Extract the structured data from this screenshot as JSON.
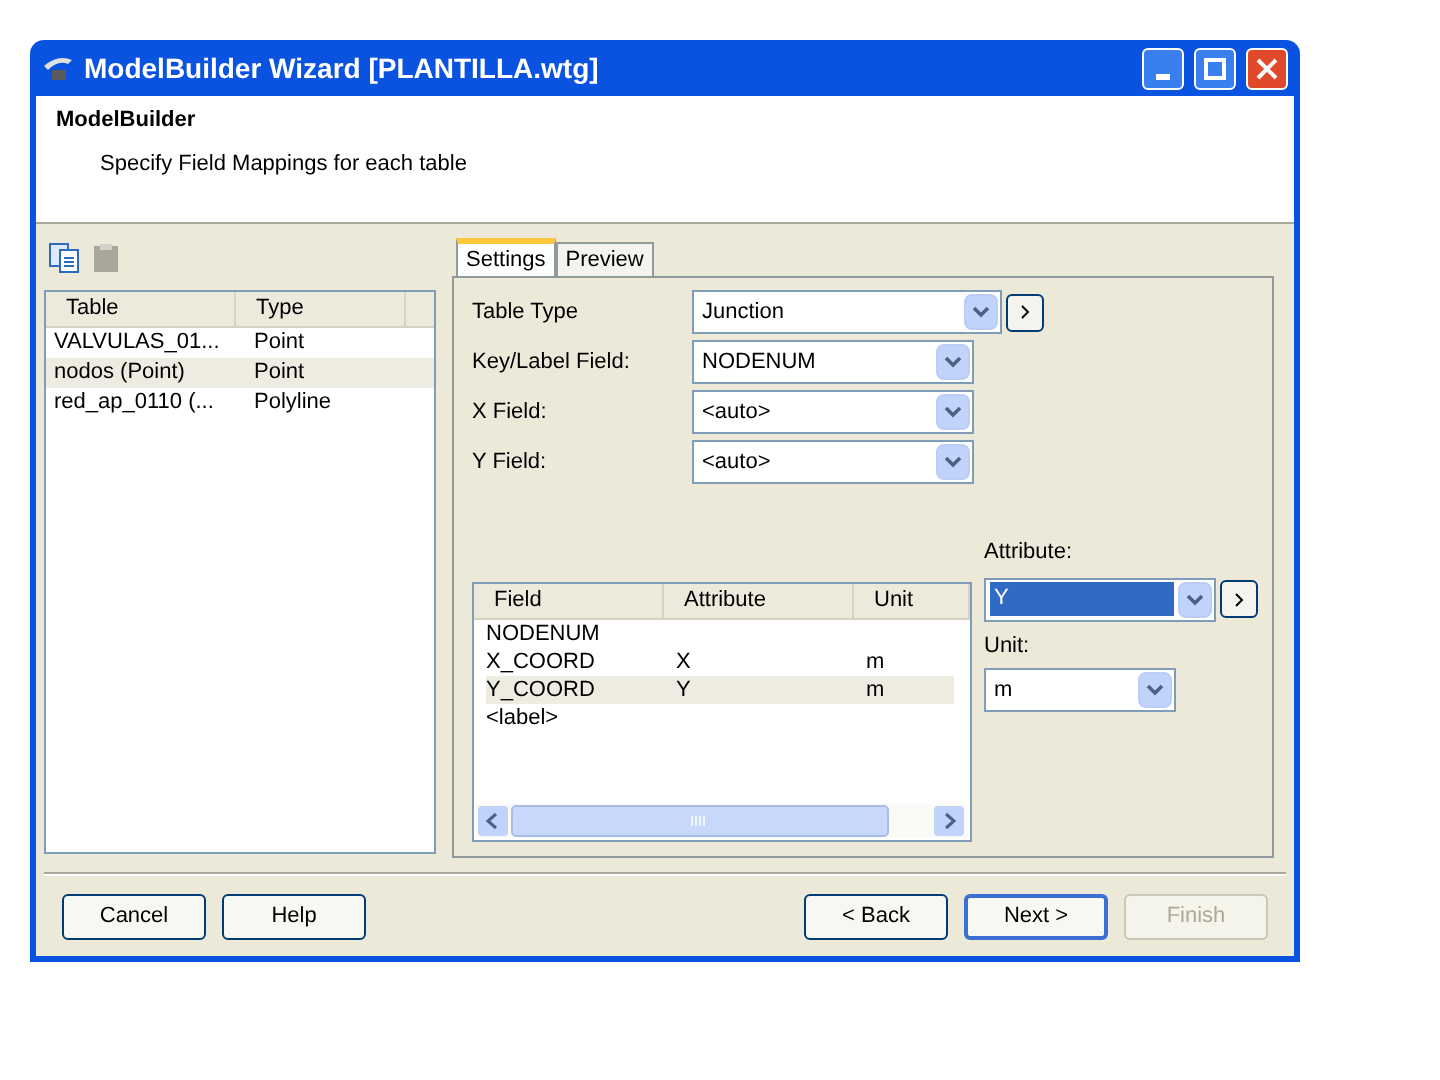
{
  "window": {
    "title": "ModelBuilder Wizard [PLANTILLA.wtg]"
  },
  "header": {
    "title": "ModelBuilder",
    "subtitle": "Specify Field Mappings for each table"
  },
  "toolbar": [
    {
      "kind": "copy",
      "disabled": false
    },
    {
      "kind": "paste",
      "disabled": true
    }
  ],
  "tables": {
    "columns": [
      "Table",
      "Type"
    ],
    "rows": [
      {
        "cells": [
          "VALVULAS_01...",
          "Point"
        ],
        "selected": false
      },
      {
        "cells": [
          "nodos (Point)",
          "Point"
        ],
        "selected": true
      },
      {
        "cells": [
          "red_ap_0110 (...",
          "Polyline"
        ],
        "selected": false
      }
    ]
  },
  "tabs": [
    {
      "label": "Settings",
      "selected": true
    },
    {
      "label": "Preview",
      "selected": false
    }
  ],
  "form": [
    {
      "label": "Table Type",
      "value": "Junction",
      "more_button": true
    },
    {
      "label": "Key/Label Field:",
      "value": "NODENUM",
      "more_button": false
    },
    {
      "label": "X Field:",
      "value": "<auto>",
      "more_button": false
    },
    {
      "label": "Y Field:",
      "value": "<auto>",
      "more_button": false
    }
  ],
  "mappings": {
    "columns": [
      "Field",
      "Attribute",
      "Unit"
    ],
    "rows": [
      {
        "cells": [
          "NODENUM",
          "",
          ""
        ],
        "selected": false
      },
      {
        "cells": [
          "X_COORD",
          "X",
          "m"
        ],
        "selected": false
      },
      {
        "cells": [
          "Y_COORD",
          "Y",
          "m"
        ],
        "selected": true
      },
      {
        "cells": [
          "<label>",
          "",
          ""
        ],
        "selected": false
      }
    ]
  },
  "attribute": {
    "label": "Attribute:",
    "value": "Y",
    "highlighted": true
  },
  "unit": {
    "label": "Unit:",
    "value": "m"
  },
  "buttons": [
    {
      "label": "Cancel",
      "disabled": false,
      "default": false
    },
    {
      "label": "Help",
      "disabled": false,
      "default": false
    },
    {
      "label": "< Back",
      "disabled": false,
      "default": false
    },
    {
      "label": "Next >",
      "disabled": false,
      "default": true
    },
    {
      "label": "Finish",
      "disabled": true,
      "default": false
    }
  ]
}
